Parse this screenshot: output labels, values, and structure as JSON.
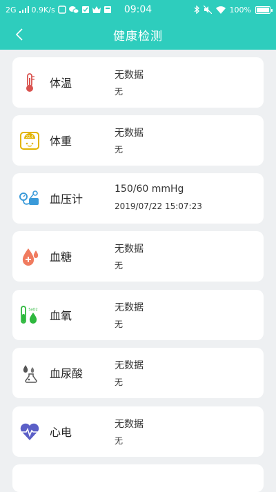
{
  "status_bar": {
    "network": "2G",
    "speed": "0.9K/s",
    "time": "09:04",
    "battery": "100%"
  },
  "nav": {
    "title": "健康检测"
  },
  "items": [
    {
      "name": "体温",
      "value": "无数据",
      "time": "无",
      "icon": "thermometer-icon"
    },
    {
      "name": "体重",
      "value": "无数据",
      "time": "无",
      "icon": "scale-icon"
    },
    {
      "name": "血压计",
      "value": "150/60 mmHg",
      "time": "2019/07/22 15:07:23",
      "icon": "blood-pressure-icon"
    },
    {
      "name": "血糖",
      "value": "无数据",
      "time": "无",
      "icon": "blood-drop-icon"
    },
    {
      "name": "血氧",
      "value": "无数据",
      "time": "无",
      "icon": "oxygen-tube-icon"
    },
    {
      "name": "血尿酸",
      "value": "无数据",
      "time": "无",
      "icon": "uric-acid-icon"
    },
    {
      "name": "心电",
      "value": "无数据",
      "time": "无",
      "icon": "heart-ecg-icon"
    }
  ],
  "icon_text": {
    "scale": "22.6",
    "oxygen": "SaO2"
  },
  "colors": {
    "primary": "#2ecdbd",
    "background": "#eef0f2"
  }
}
